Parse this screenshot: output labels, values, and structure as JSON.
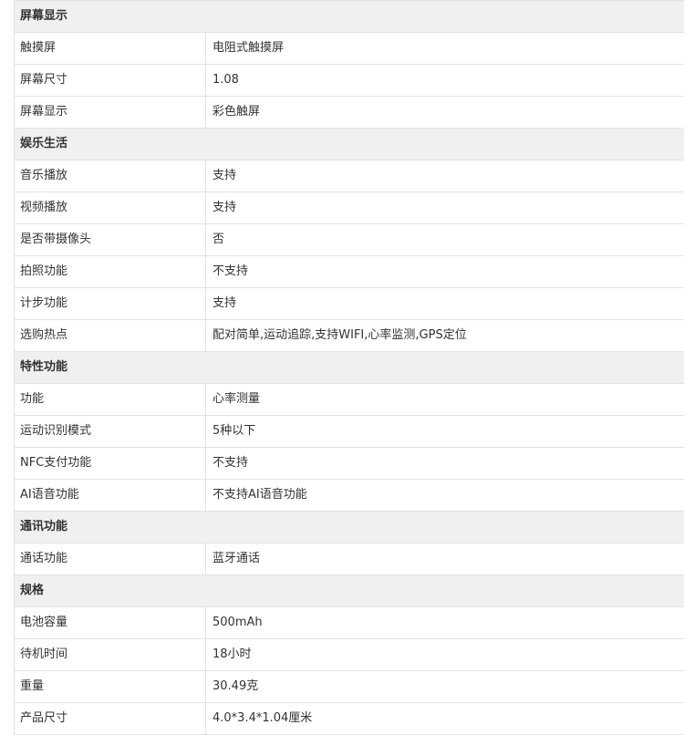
{
  "sections": [
    {
      "title": "屏幕显示",
      "rows": [
        {
          "label": "触摸屏",
          "value": "电阻式触摸屏"
        },
        {
          "label": "屏幕尺寸",
          "value": "1.08"
        },
        {
          "label": "屏幕显示",
          "value": "彩色触屏"
        }
      ]
    },
    {
      "title": "娱乐生活",
      "rows": [
        {
          "label": "音乐播放",
          "value": "支持"
        },
        {
          "label": "视频播放",
          "value": "支持"
        },
        {
          "label": "是否带摄像头",
          "value": "否"
        },
        {
          "label": "拍照功能",
          "value": "不支持"
        },
        {
          "label": "计步功能",
          "value": "支持"
        },
        {
          "label": "选购热点",
          "value": "配对简单,运动追踪,支持WIFI,心率监测,GPS定位"
        }
      ]
    },
    {
      "title": "特性功能",
      "rows": [
        {
          "label": "功能",
          "value": "心率测量"
        },
        {
          "label": "运动识别模式",
          "value": "5种以下"
        },
        {
          "label": "NFC支付功能",
          "value": "不支持"
        },
        {
          "label": "AI语音功能",
          "value": "不支持AI语音功能"
        }
      ]
    },
    {
      "title": "通讯功能",
      "rows": [
        {
          "label": "通话功能",
          "value": "蓝牙通话"
        }
      ]
    },
    {
      "title": "规格",
      "rows": [
        {
          "label": "电池容量",
          "value": "500mAh"
        },
        {
          "label": "待机时间",
          "value": "18小时"
        },
        {
          "label": "重量",
          "value": "30.49克"
        },
        {
          "label": "产品尺寸",
          "value": "4.0*3.4*1.04厘米"
        }
      ]
    }
  ]
}
